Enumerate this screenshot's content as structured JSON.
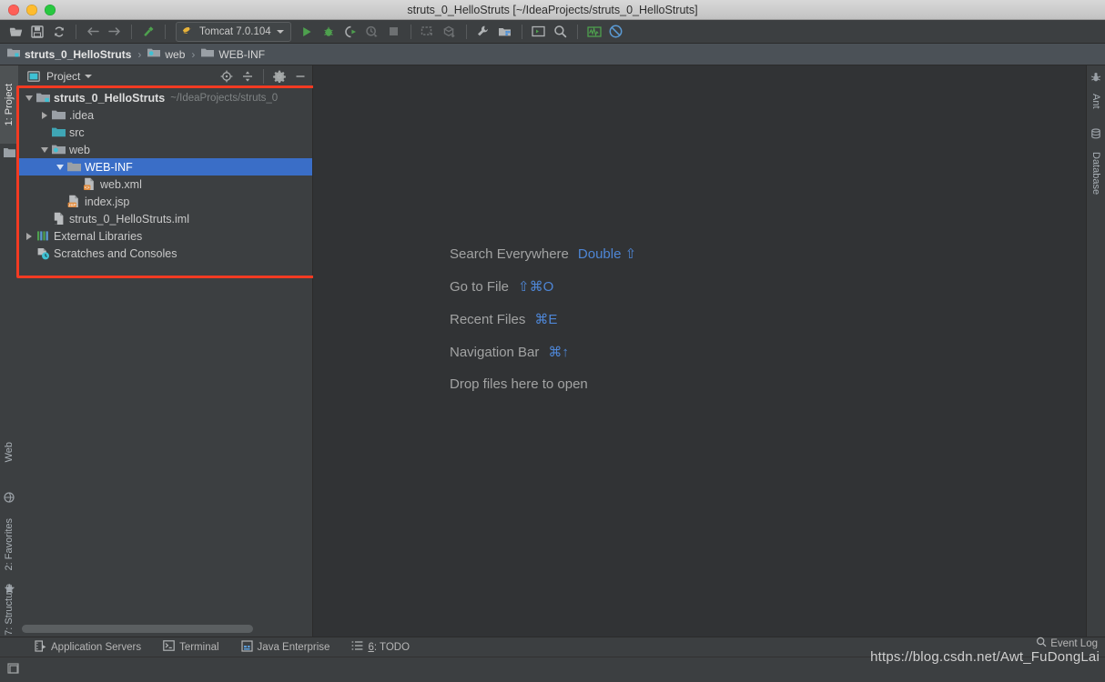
{
  "window": {
    "title": "struts_0_HelloStruts [~/IdeaProjects/struts_0_HelloStruts]",
    "traffic": [
      "close",
      "minimize",
      "zoom"
    ]
  },
  "toolbar": {
    "items": [
      {
        "name": "open-folder-icon",
        "tip": "Open"
      },
      {
        "name": "save-all-icon",
        "tip": "Save All"
      },
      {
        "name": "sync-icon",
        "tip": "Synchronize"
      },
      {
        "name": "back-icon",
        "tip": "Back"
      },
      {
        "name": "forward-icon",
        "tip": "Forward"
      },
      {
        "name": "build-hammer-icon",
        "tip": "Build Project"
      },
      {
        "name": "run-icon",
        "tip": "Run"
      },
      {
        "name": "debug-icon",
        "tip": "Debug"
      },
      {
        "name": "run-coverage-icon",
        "tip": "Run with Coverage"
      },
      {
        "name": "profile-icon",
        "tip": "Profile"
      },
      {
        "name": "stop-icon",
        "tip": "Stop"
      },
      {
        "name": "update-app-icon",
        "tip": "Update Application"
      },
      {
        "name": "deploy-icon",
        "tip": "Deploy"
      },
      {
        "name": "settings-wrench-icon",
        "tip": "Settings"
      },
      {
        "name": "project-structure-icon",
        "tip": "Project Structure"
      },
      {
        "name": "terminal-icon",
        "tip": "Terminal"
      },
      {
        "name": "search-icon",
        "tip": "Search Everywhere"
      },
      {
        "name": "monitor-icon",
        "tip": "Activity Monitor"
      },
      {
        "name": "no-entry-icon",
        "tip": "Disabled"
      }
    ],
    "run_config": {
      "label": "Tomcat 7.0.104",
      "icon": "tomcat-icon",
      "caret": "chevron-down-icon"
    }
  },
  "breadcrumb": {
    "items": [
      {
        "label": "struts_0_HelloStruts",
        "icon": "module-icon"
      },
      {
        "label": "web",
        "icon": "web-folder-icon"
      },
      {
        "label": "WEB-INF",
        "icon": "folder-icon"
      }
    ],
    "separator": "›"
  },
  "left_toolwindows": {
    "top": [
      {
        "label": "1: Project",
        "icon": "project-icon",
        "active": true
      }
    ],
    "bottom": [
      {
        "label": "Web",
        "icon": "web-icon"
      },
      {
        "label": "2: Favorites",
        "icon": "star-icon"
      },
      {
        "label": "7: Structure",
        "icon": "structure-icon"
      }
    ]
  },
  "right_toolwindows": {
    "items": [
      {
        "label": "Ant",
        "icon": "ant-icon"
      },
      {
        "label": "Database",
        "icon": "database-icon"
      }
    ]
  },
  "project_panel": {
    "title": "Project",
    "title_icon": "project-view-icon",
    "dropdown": "chevron-down-icon",
    "actions": [
      {
        "name": "scroll-from-source-icon",
        "label": "Select Opened File"
      },
      {
        "name": "collapse-all-icon",
        "label": "Collapse All"
      },
      {
        "name": "gear-icon",
        "label": "Settings"
      },
      {
        "name": "hide-icon",
        "label": "Hide"
      }
    ],
    "tree": [
      {
        "label": "struts_0_HelloStruts",
        "sub": "~/IdeaProjects/struts_0",
        "indent": 0,
        "arrow": "down",
        "icon": "project-module-icon",
        "bold": true,
        "selected": false
      },
      {
        "label": ".idea",
        "sub": "",
        "indent": 1,
        "arrow": "right",
        "icon": "folder-icon",
        "bold": false,
        "selected": false
      },
      {
        "label": "src",
        "sub": "",
        "indent": 1,
        "arrow": "none",
        "icon": "source-folder-icon",
        "bold": false,
        "selected": false
      },
      {
        "label": "web",
        "sub": "",
        "indent": 1,
        "arrow": "down",
        "icon": "web-folder-icon",
        "bold": false,
        "selected": false
      },
      {
        "label": "WEB-INF",
        "sub": "",
        "indent": 2,
        "arrow": "down",
        "icon": "folder-icon",
        "bold": false,
        "selected": true
      },
      {
        "label": "web.xml",
        "sub": "",
        "indent": 3,
        "arrow": "none",
        "icon": "xml-file-icon",
        "bold": false,
        "selected": false
      },
      {
        "label": "index.jsp",
        "sub": "",
        "indent": 2,
        "arrow": "none",
        "icon": "jsp-file-icon",
        "bold": false,
        "selected": false
      },
      {
        "label": "struts_0_HelloStruts.iml",
        "sub": "",
        "indent": 1,
        "arrow": "none",
        "icon": "iml-file-icon",
        "bold": false,
        "selected": false
      },
      {
        "label": "External Libraries",
        "sub": "",
        "indent": 0,
        "arrow": "right",
        "icon": "libraries-icon",
        "bold": false,
        "selected": false
      },
      {
        "label": "Scratches and Consoles",
        "sub": "",
        "indent": 0,
        "arrow": "none",
        "icon": "scratches-icon",
        "bold": false,
        "selected": false
      }
    ],
    "annotation_color": "#f23a22"
  },
  "editor": {
    "background": "#313335",
    "hints": [
      {
        "name": "Search Everywhere",
        "key": "Double ⇧"
      },
      {
        "name": "Go to File",
        "key": "⇧⌘O"
      },
      {
        "name": "Recent Files",
        "key": "⌘E"
      },
      {
        "name": "Navigation Bar",
        "key": "⌘↑"
      },
      {
        "name": "Drop files here to open",
        "key": ""
      }
    ]
  },
  "bottom_toolwindows": {
    "items": [
      {
        "label": "Application Servers",
        "icon": "app-servers-icon",
        "num": ""
      },
      {
        "label": "Terminal",
        "icon": "terminal-icon",
        "num": ""
      },
      {
        "label": "Java Enterprise",
        "icon": "java-enterprise-icon",
        "num": ""
      },
      {
        "label": "6: TODO",
        "icon": "todo-icon",
        "num": "6"
      }
    ]
  },
  "statusbar": {
    "left_icon": "toggle-toolwindows-icon",
    "event_log": "Event Log",
    "event_log_icon": "event-log-icon",
    "watermark": "https://blog.csdn.net/Awt_FuDongLai"
  },
  "colors": {
    "accent_blue": "#4e86d6",
    "selection_blue": "#3a6ec7",
    "panel_bg": "#3c3f41",
    "editor_bg": "#313335",
    "crumb_bg": "#4b5157",
    "annotation_red": "#f23a22",
    "run_green": "#4ea04e"
  }
}
